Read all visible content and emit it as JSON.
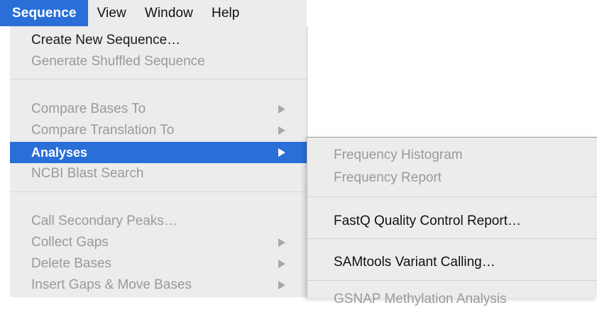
{
  "menubar": {
    "items": [
      "Sequence",
      "View",
      "Window",
      "Help"
    ]
  },
  "menu": {
    "items": [
      {
        "label": "Create New Sequence…",
        "enabled": true
      },
      {
        "label": "Generate Shuffled Sequence",
        "enabled": false
      },
      {
        "label": "Compare Bases To",
        "enabled": false,
        "submenu": true
      },
      {
        "label": "Compare Translation To",
        "enabled": false,
        "submenu": true
      },
      {
        "label": "Analyses",
        "enabled": true,
        "submenu": true,
        "highlighted": true
      },
      {
        "label": "NCBI Blast Search",
        "enabled": false
      },
      {
        "label": "Call Secondary Peaks…",
        "enabled": false
      },
      {
        "label": "Collect Gaps",
        "enabled": false,
        "submenu": true
      },
      {
        "label": "Delete Bases",
        "enabled": false,
        "submenu": true
      },
      {
        "label": "Insert Gaps & Move Bases",
        "enabled": false,
        "submenu": true
      }
    ]
  },
  "submenu": {
    "items": [
      {
        "label": "Frequency Histogram",
        "enabled": false
      },
      {
        "label": "Frequency Report",
        "enabled": false
      },
      {
        "label": "FastQ Quality Control Report…",
        "enabled": true
      },
      {
        "label": "SAMtools Variant Calling…",
        "enabled": true
      },
      {
        "label": "GSNAP Methylation Analysis",
        "enabled": false
      }
    ]
  },
  "colors": {
    "highlight": "#2a6fd8",
    "menu_bg": "#ececec",
    "disabled_text": "#9a9a9a"
  }
}
